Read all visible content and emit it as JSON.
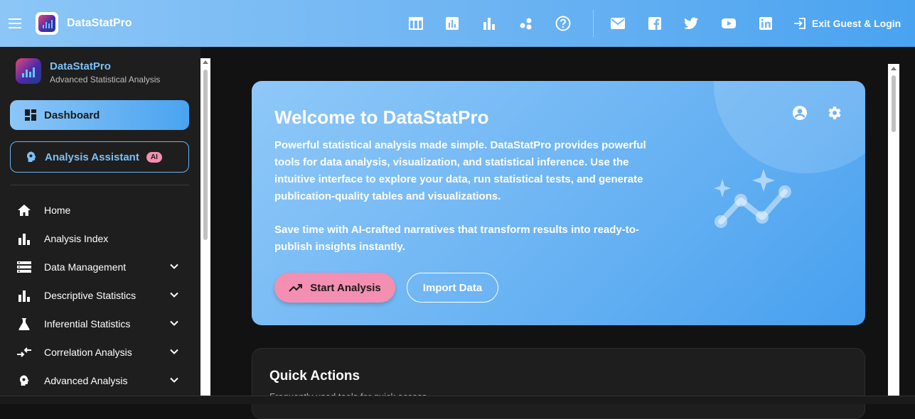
{
  "appbar": {
    "brand": "DataStatPro",
    "login_label": "Exit Guest & Login"
  },
  "sidebar": {
    "title": "DataStatPro",
    "subtitle": "Advanced Statistical Analysis",
    "dashboard_label": "Dashboard",
    "assistant_label": "Analysis Assistant",
    "assistant_badge": "AI",
    "items": [
      {
        "label": "Home",
        "icon": "home-icon",
        "expandable": false
      },
      {
        "label": "Analysis Index",
        "icon": "bar-chart-icon",
        "expandable": false
      },
      {
        "label": "Data Management",
        "icon": "storage-icon",
        "expandable": true
      },
      {
        "label": "Descriptive Statistics",
        "icon": "bar-chart-icon",
        "expandable": true
      },
      {
        "label": "Inferential Statistics",
        "icon": "flask-icon",
        "expandable": true
      },
      {
        "label": "Correlation Analysis",
        "icon": "compare-arrows-icon",
        "expandable": true
      },
      {
        "label": "Advanced Analysis",
        "icon": "brain-icon",
        "expandable": true
      }
    ]
  },
  "hero": {
    "title": "Welcome to DataStatPro",
    "paragraph1": "Powerful statistical analysis made simple. DataStatPro provides powerful tools for data analysis, visualization, and statistical inference. Use the intuitive interface to explore your data, run statistical tests, and generate publication-quality tables and visualizations.",
    "paragraph2": "Save time with AI-crafted narratives that transform results into ready-to-publish insights instantly.",
    "start_label": "Start Analysis",
    "import_label": "Import Data"
  },
  "quick_actions": {
    "title": "Quick Actions",
    "subtitle": "Frequently used tools for quick access"
  },
  "colors": {
    "accent": "#4aa3f0",
    "pink": "#f48fb1",
    "bg": "#121212",
    "sidebar": "#1e1e1e"
  }
}
